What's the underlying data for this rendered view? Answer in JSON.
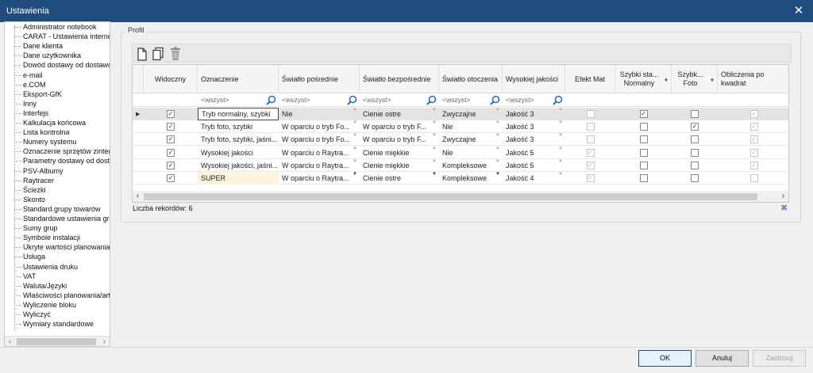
{
  "window": {
    "title": "Ustawienia"
  },
  "tree": {
    "items": [
      "Administrator notebook",
      "CARAT - Ustawienia internetu",
      "Dane klienta",
      "Dane użytkownika",
      "Dowód dostawy od dostawcy",
      "e-mail",
      "e.COM",
      "Eksport-GfK",
      "Inny",
      "Interfejs",
      "Kalkulacja końcowa",
      "Lista kontrolna",
      "Numery systemu",
      "Oznaczenie sprzętów zintegrow",
      "Parametry dostawy od dostaw",
      "PSV-Albumy",
      "Raytracer",
      "Ścieżki",
      "Skonto",
      "Standard.grupy towarów",
      "Standardowe ustawienia graf",
      "Sumy grup",
      "Symbole instalacji",
      "Ukryte wartości planowania",
      "Usługa",
      "Ustawienia druku",
      "VAT",
      "Waluta/Języki",
      "Właściwości planowania/arty",
      "Wyliczenie bloku",
      "Wyliczyć",
      "Wymiary standardowe"
    ]
  },
  "profile": {
    "label": "Profil"
  },
  "grid": {
    "columns": [
      {
        "label": "Widoczny"
      },
      {
        "label": "Oznaczenie"
      },
      {
        "label": "Światło pośrednie"
      },
      {
        "label": "Światło bezpośrednie"
      },
      {
        "label": "Światło otoczenia"
      },
      {
        "label": "Wysokiej jakości"
      },
      {
        "label": "Efekt Mat"
      },
      {
        "label": "Szybki sta... Normalny"
      },
      {
        "label": "Szybk... Foto"
      },
      {
        "label": "Obliczenia po kwadrat"
      }
    ],
    "filter_placeholder": "<wszyst>",
    "rows": [
      {
        "visible": true,
        "name": "Tryb normalny, szybki",
        "indirect": "Nie",
        "direct": "Cienie ostre",
        "ambient": "Zwyczajne",
        "hq": "Jakość 3",
        "mat": false,
        "fast_normal": true,
        "fast_photo": false,
        "calc": true
      },
      {
        "visible": true,
        "name": "Tryb foto, szybki",
        "indirect": "W oparciu o tryb Fo...",
        "direct": "W oparciu o tryb F...",
        "ambient": "Nie",
        "hq": "Jakość 3",
        "mat": false,
        "fast_normal": false,
        "fast_photo": true,
        "calc": true
      },
      {
        "visible": true,
        "name": "Tryb foto, szybki, jaśni...",
        "indirect": "W oparciu o tryb Fo...",
        "direct": "W oparciu o tryb F...",
        "ambient": "Zwyczajne",
        "hq": "Jakość 3",
        "mat": false,
        "fast_normal": false,
        "fast_photo": false,
        "calc": true
      },
      {
        "visible": true,
        "name": "Wysokiej jakości",
        "indirect": "W oparciu o Raytra...",
        "direct": "Cienie miękkie",
        "ambient": "Nie",
        "hq": "Jakość 5",
        "mat": true,
        "fast_normal": false,
        "fast_photo": false,
        "calc": true
      },
      {
        "visible": true,
        "name": "Wysokiej jakości, jaśni...",
        "indirect": "W oparciu o Raytra...",
        "direct": "Cienie miękkie",
        "ambient": "Kompleksowe",
        "hq": "Jakość 5",
        "mat": true,
        "fast_normal": false,
        "fast_photo": false,
        "calc": true
      },
      {
        "visible": true,
        "name": "SUPER",
        "indirect": "W oparciu o Raytra...",
        "direct": "Cienie ostre",
        "ambient": "Kompleksowe",
        "hq": "Jakość 4",
        "mat": true,
        "fast_normal": false,
        "fast_photo": false,
        "calc": false
      }
    ],
    "record_count": "Liczba rekordów: 6"
  },
  "buttons": {
    "ok": "OK",
    "cancel": "Anuluj",
    "apply": "Zastosuj"
  }
}
